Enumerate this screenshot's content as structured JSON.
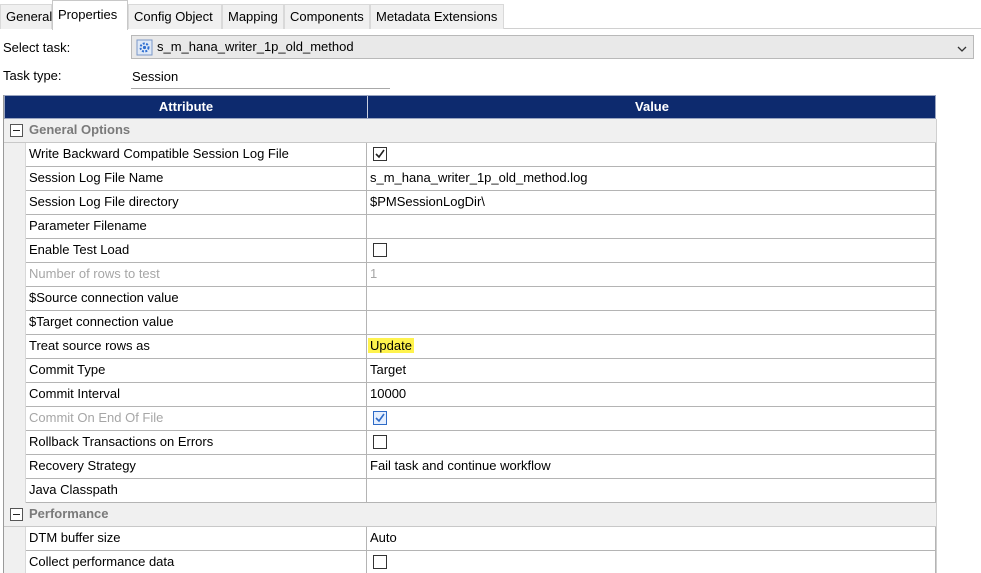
{
  "tabs": [
    "General",
    "Properties",
    "Config Object",
    "Mapping",
    "Components",
    "Metadata Extensions"
  ],
  "active_tab": "Properties",
  "select_task": {
    "label": "Select task:",
    "value": "s_m_hana_writer_1p_old_method",
    "icon": "session-gear-icon"
  },
  "task_type": {
    "label": "Task type:",
    "value": "Session"
  },
  "grid": {
    "header_attribute": "Attribute",
    "header_value": "Value",
    "groups": [
      {
        "title": "General Options",
        "rows": [
          {
            "attr": "Write Backward Compatible Session Log File",
            "kind": "checkbox",
            "checked": true
          },
          {
            "attr": "Session Log File Name",
            "value": "s_m_hana_writer_1p_old_method.log"
          },
          {
            "attr": "Session Log File directory",
            "value": "$PMSessionLogDir\\"
          },
          {
            "attr": "Parameter Filename",
            "value": ""
          },
          {
            "attr": "Enable Test Load",
            "kind": "checkbox",
            "checked": false
          },
          {
            "attr": "Number of rows to test",
            "value": "1",
            "disabled": true
          },
          {
            "attr": "$Source connection value",
            "value": ""
          },
          {
            "attr": "$Target connection value",
            "value": ""
          },
          {
            "attr": "Treat source rows as",
            "value": "Update",
            "highlight": true
          },
          {
            "attr": "Commit Type",
            "value": "Target"
          },
          {
            "attr": "Commit Interval",
            "value": "10000"
          },
          {
            "attr": "Commit On End Of File",
            "kind": "checkbox",
            "checked": true,
            "disabled": true
          },
          {
            "attr": "Rollback Transactions on Errors",
            "kind": "checkbox",
            "checked": false
          },
          {
            "attr": "Recovery Strategy",
            "value": "Fail task and continue workflow"
          },
          {
            "attr": "Java Classpath",
            "value": ""
          }
        ]
      },
      {
        "title": "Performance",
        "rows": [
          {
            "attr": "DTM buffer size",
            "value": "Auto"
          },
          {
            "attr": "Collect performance data",
            "kind": "checkbox",
            "checked": false
          }
        ]
      }
    ]
  },
  "colors": {
    "header_bg": "#0d2a6e",
    "highlight": "#fff34d",
    "group_title": "#7a7a7a"
  }
}
